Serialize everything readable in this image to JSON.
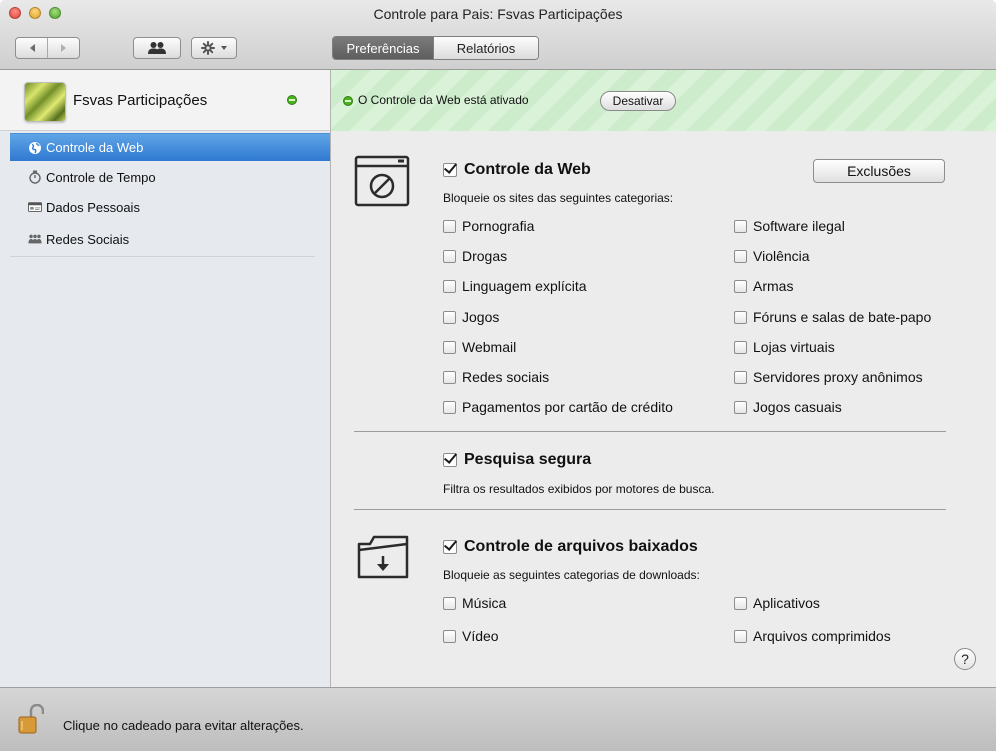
{
  "window": {
    "title": "Controle para Pais: Fsvas Participações"
  },
  "toolbar": {
    "back_icon": "back-arrow-icon",
    "forward_icon": "forward-arrow-icon",
    "users_icon": "users-icon",
    "gear_icon": "gear-icon",
    "tabs": [
      {
        "label": "Preferências",
        "active": true
      },
      {
        "label": "Relatórios",
        "active": false
      }
    ]
  },
  "sidebar": {
    "profile": {
      "name": "Fsvas Participações",
      "status": "active"
    },
    "items": [
      {
        "label": "Controle da Web",
        "icon": "globe-icon",
        "selected": true
      },
      {
        "label": "Controle de Tempo",
        "icon": "stopwatch-icon",
        "selected": false
      },
      {
        "label": "Dados Pessoais",
        "icon": "id-card-icon",
        "selected": false
      },
      {
        "label": "Redes Sociais",
        "icon": "people-icon",
        "selected": false
      }
    ]
  },
  "banner": {
    "text": "O Controle da Web está ativado",
    "button": "Desativar",
    "accent": "#49b31e"
  },
  "web_control": {
    "title": "Controle da Web",
    "checked": true,
    "subtitle": "Bloqueie os sites das seguintes categorias:",
    "exclusions_button": "Exclusões",
    "left_options": [
      "Pornografia",
      "Drogas",
      "Linguagem explícita",
      "Jogos",
      "Webmail",
      "Redes sociais",
      "Pagamentos por cartão de crédito"
    ],
    "right_options": [
      "Software ilegal",
      "Violência",
      "Armas",
      "Fóruns e salas de bate-papo",
      "Lojas virtuais",
      "Servidores proxy anônimos",
      "Jogos casuais"
    ]
  },
  "safe_search": {
    "title": "Pesquisa segura",
    "checked": true,
    "subtitle": "Filtra os resultados exibidos por motores de busca."
  },
  "downloads": {
    "title": "Controle de arquivos baixados",
    "checked": true,
    "subtitle": "Bloqueie as seguintes categorias de downloads:",
    "left_options": [
      "Música",
      "Vídeo"
    ],
    "right_options": [
      "Aplicativos",
      "Arquivos comprimidos"
    ]
  },
  "help_label": "?",
  "bottom": {
    "text": "Clique no cadeado para evitar alterações.",
    "icon": "lock-icon"
  }
}
